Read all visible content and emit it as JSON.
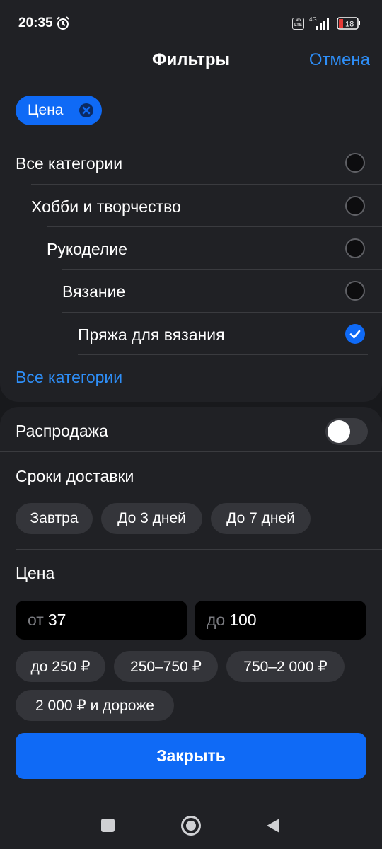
{
  "status_bar": {
    "time": "20:35",
    "network": "4G",
    "volte": "Vo LTE",
    "battery": "18"
  },
  "header": {
    "title": "Фильтры",
    "cancel_label": "Отмена"
  },
  "active_chip": {
    "label": "Цена"
  },
  "categories": {
    "items": [
      {
        "label": "Все категории",
        "selected": false
      },
      {
        "label": "Хобби и творчество",
        "selected": false
      },
      {
        "label": "Рукоделие",
        "selected": false
      },
      {
        "label": "Вязание",
        "selected": false
      },
      {
        "label": "Пряжа для вязания",
        "selected": true
      }
    ],
    "all_link": "Все категории"
  },
  "sale": {
    "label": "Распродажа",
    "enabled": false
  },
  "delivery": {
    "title": "Сроки доставки",
    "options": [
      "Завтра",
      "До 3 дней",
      "До 7 дней"
    ]
  },
  "price": {
    "title": "Цена",
    "from_prefix": "от",
    "from_value": "37",
    "to_prefix": "до",
    "to_value": "100",
    "presets": [
      "до 250 ₽",
      "250–750 ₽",
      "750–2 000 ₽",
      "2 000 ₽ и дороже"
    ]
  },
  "footer": {
    "close_label": "Закрыть"
  },
  "colors": {
    "accent": "#0f6af6",
    "link": "#2e8ef7",
    "background": "#18191c",
    "surface": "#202125",
    "chip": "#34353a"
  },
  "icons": {
    "alarm": "alarm-clock-icon",
    "chip_close": "close-circle-icon",
    "checked": "checkmark-icon",
    "nav_recent": "square-icon",
    "nav_home": "circle-icon",
    "nav_back": "triangle-back-icon"
  }
}
